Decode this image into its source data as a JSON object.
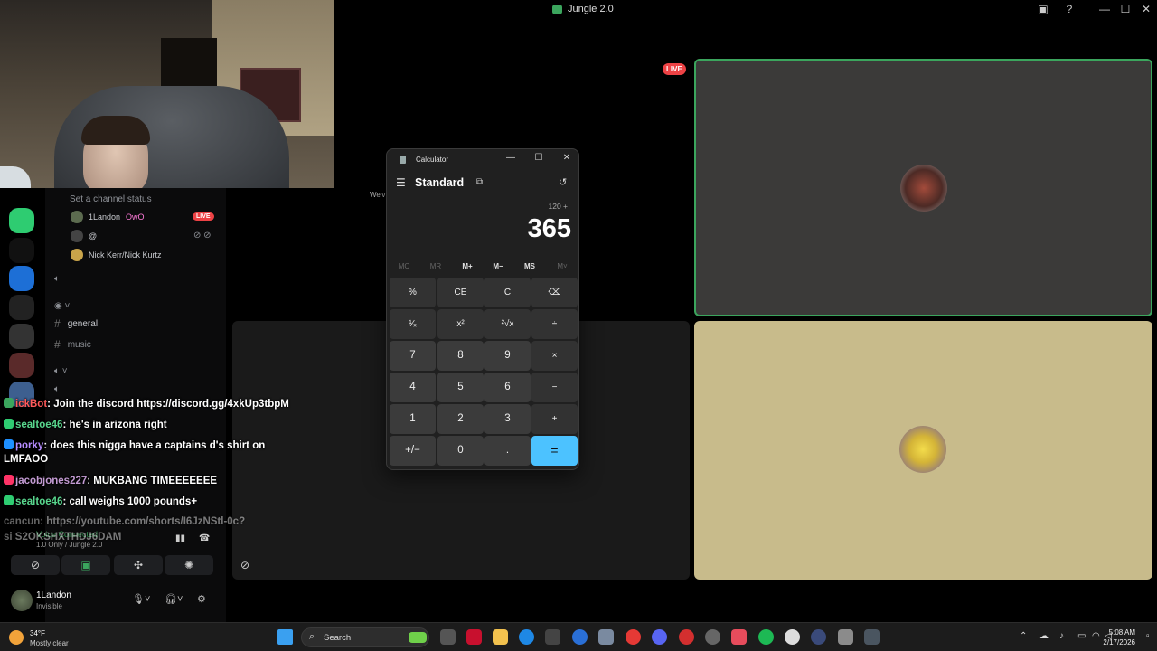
{
  "window": {
    "title": "Jungle 2.0",
    "minimize": "—",
    "maximize": "☐",
    "close": "✕"
  },
  "discord": {
    "channel_status": "Set a channel status",
    "voice_users": [
      {
        "name": "1Landon",
        "tag": "OwO",
        "live": "LIVE"
      },
      {
        "name": "@"
      },
      {
        "name": "Nick Kerr/Nick Kurtz"
      }
    ],
    "text_channels": [
      "general",
      "music"
    ],
    "voice_connected": "Voice Connected",
    "voice_channel": "1.0 Only / Jungle 2.0",
    "user": {
      "name": "1Landon",
      "status": "Invisible"
    }
  },
  "chat": [
    {
      "user": "ickBot",
      "user_color": "#ff5a5a",
      "badge_color": "#3ba55d",
      "message": "Join the discord https://discord.gg/4xkUp3tbpM"
    },
    {
      "user": "sealtoe46",
      "user_color": "#58d68d",
      "badge_color": "#2ecc71",
      "message": "he's in arizona right"
    },
    {
      "user": "porky",
      "user_color": "#b58cff",
      "badge_color": "#1e90ff",
      "message": "does this nigga have a captains d's shirt on"
    },
    {
      "user": "",
      "user_color": "#ffffff",
      "badge_color": "",
      "message": "LMFAOO"
    },
    {
      "user": "jacobjones227",
      "user_color": "#c39bd3",
      "badge_color": "#ff3366",
      "message": "MUKBANG TIMEEEEEEE"
    },
    {
      "user": "sealtoe46",
      "user_color": "#58d68d",
      "badge_color": "#2ecc71",
      "message": "call weighs 1000 pounds+"
    },
    {
      "user": "cancun",
      "user_color": "#dddddd",
      "badge_color": "",
      "message": "https://youtube.com/shorts/I6JzNStl-0c?"
    },
    {
      "user": "si",
      "user_color": "#dddddd",
      "badge_color": "",
      "message": "S2OKSHXTHDJ6DAM"
    }
  ],
  "stream": {
    "live_label": "LIVE",
    "center_text": "We'v"
  },
  "calculator": {
    "title": "Calculator",
    "mode": "Standard",
    "expression": "120 +",
    "display": "365",
    "memory": [
      {
        "label": "MC",
        "enabled": false
      },
      {
        "label": "MR",
        "enabled": false
      },
      {
        "label": "M+",
        "enabled": true
      },
      {
        "label": "M−",
        "enabled": true
      },
      {
        "label": "MS",
        "enabled": true
      },
      {
        "label": "M˅",
        "enabled": false
      }
    ],
    "keys": [
      [
        "%",
        "CE",
        "C",
        "⌫"
      ],
      [
        "¹⁄ₓ",
        "x²",
        "²√x",
        "÷"
      ],
      [
        "7",
        "8",
        "9",
        "×"
      ],
      [
        "4",
        "5",
        "6",
        "−"
      ],
      [
        "1",
        "2",
        "3",
        "+"
      ],
      [
        "+/−",
        "0",
        ".",
        "="
      ]
    ]
  },
  "taskbar": {
    "weather_temp": "34°F",
    "weather_desc": "Mostly clear",
    "search_label": "Search",
    "time": "5:08 AM",
    "date": "2/17/2026"
  }
}
